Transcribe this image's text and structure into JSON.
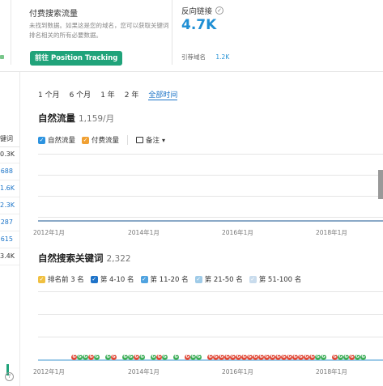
{
  "paid_traffic": {
    "title": "付费搜索流量",
    "description": "未找到数据。如果这是您的域名，您可以获取关键词排名相关的所有必要数据。",
    "button_label": "前往 Position Tracking"
  },
  "backlinks": {
    "title": "反向链接",
    "info_icon": "info-icon",
    "value": "4.7K",
    "referring_domains_label": "引荐域名",
    "referring_domains_value": "1.2K"
  },
  "left_table": {
    "header": "键词",
    "cells": [
      {
        "text": "0.3K",
        "color": "#333333"
      },
      {
        "text": "688",
        "color": "#1a73c7"
      },
      {
        "text": "1.6K",
        "color": "#1a73c7"
      },
      {
        "text": "2.3K",
        "color": "#1a73c7"
      },
      {
        "text": "287",
        "color": "#1a73c7"
      },
      {
        "text": "615",
        "color": "#1a73c7"
      },
      {
        "text": "3.4K",
        "color": "#333333"
      }
    ],
    "help_icon": "question-icon"
  },
  "time_range": {
    "tabs": [
      "1 个月",
      "6 个月",
      "1 年",
      "2 年",
      "全部时间"
    ],
    "active_index": 4
  },
  "organic_traffic": {
    "title": "自然流量",
    "subtitle": "1,159/月",
    "legend": [
      {
        "label": "自然流量",
        "color": "#2c93e0",
        "checked": true
      },
      {
        "label": "付费流量",
        "color": "#f0a032",
        "checked": true
      }
    ],
    "notes_label": "备注",
    "notes_icon": "note-icon",
    "dropdown_icon": "chevron-down-icon"
  },
  "organic_keywords": {
    "title": "自然搜索关键词",
    "subtitle": "2,322",
    "legend": [
      {
        "label": "排名前 3 名",
        "color": "#f0c040",
        "checked": true
      },
      {
        "label": "第 4-10 名",
        "color": "#1e73c9",
        "checked": true
      },
      {
        "label": "第 11-20 名",
        "color": "#4fa3e0",
        "checked": true
      },
      {
        "label": "第 21-50 名",
        "color": "#9fcbe8",
        "checked": true
      },
      {
        "label": "第 51-100 名",
        "color": "#c9dced",
        "checked": true
      }
    ]
  },
  "x_axis_ticks": [
    "2012年1月",
    "2014年1月",
    "2016年1月",
    "2018年1月"
  ],
  "chart_data": [
    {
      "type": "line",
      "title": "自然流量",
      "x_ticks": [
        "2012年1月",
        "2014年1月",
        "2016年1月",
        "2018年1月"
      ],
      "series": [
        {
          "name": "自然流量",
          "color": "#2c93e0"
        },
        {
          "name": "付费流量",
          "color": "#f0a032"
        }
      ]
    },
    {
      "type": "area",
      "title": "自然搜索关键词",
      "x_ticks": [
        "2012年1月",
        "2014年1月",
        "2016年1月",
        "2018年1月"
      ],
      "series": [
        {
          "name": "排名前 3 名",
          "color": "#f0c040"
        },
        {
          "name": "第 4-10 名",
          "color": "#1e73c9"
        },
        {
          "name": "第 11-20 名",
          "color": "#4fa3e0"
        },
        {
          "name": "第 21-50 名",
          "color": "#9fcbe8"
        },
        {
          "name": "第 51-100 名",
          "color": "#c9dced"
        }
      ]
    }
  ],
  "event_markers": {
    "colors": [
      "#3fae5a",
      "#e04b3a"
    ],
    "glyph": "G"
  }
}
